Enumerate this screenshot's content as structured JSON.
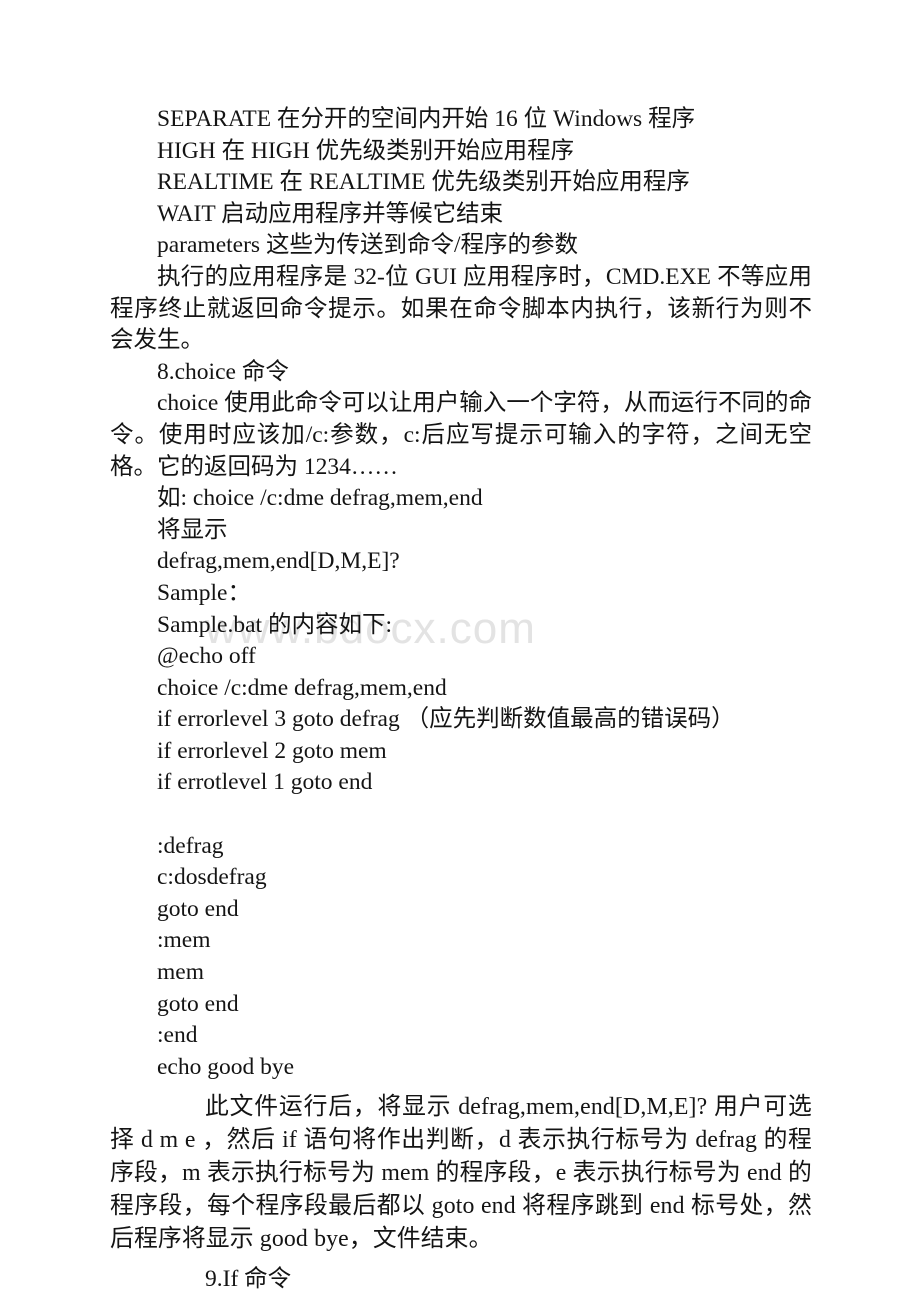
{
  "document": {
    "watermark": "www.bdocx.com",
    "text_color": "#141414",
    "watermark_color": "#e3e3e3",
    "background_color": "#ffffff",
    "start_switches": [
      "SEPARATE 在分开的空间内开始 16 位 Windows 程序",
      "HIGH 在 HIGH 优先级类别开始应用程序",
      "REALTIME 在 REALTIME 优先级类别开始应用程序",
      "WAIT 启动应用程序并等候它结束",
      "parameters 这些为传送到命令/程序的参数"
    ],
    "gui_note": "执行的应用程序是 32-位 GUI 应用程序时，CMD.EXE 不等应用程序终止就返回命令提示。如果在命令脚本内执行，该新行为则不会发生。",
    "section_choice_heading": "8.choice 命令",
    "choice_description": "choice 使用此命令可以让用户输入一个字符，从而运行不同的命令。使用时应该加/c:参数，c:后应写提示可输入的字符，之间无空格。它的返回码为 1234……",
    "example_command": "如: choice /c:dme defrag,mem,end",
    "will_display_label": "将显示",
    "display_output": "defrag,mem,end[D,M,E]?",
    "sample_label": "Sample：",
    "sample_file_label": "Sample.bat 的内容如下:",
    "batch_lines_top": [
      "@echo off",
      "choice /c:dme defrag,mem,end",
      "if errorlevel 3 goto defrag （应先判断数值最高的错误码）",
      "if errorlevel 2 goto mem",
      "if errotlevel 1 goto end"
    ],
    "batch_lines_bottom": [
      ":defrag",
      "c:dosdefrag",
      "goto end",
      ":mem",
      "mem",
      "goto end",
      ":end",
      "echo good bye"
    ],
    "explanation": "此文件运行后，将显示 defrag,mem,end[D,M,E]? 用户可选择 d m e ，然后 if 语句将作出判断，d 表示执行标号为 defrag 的程序段，m 表示执行标号为 mem 的程序段，e 表示执行标号为 end 的程序段，每个程序段最后都以 goto end 将程序跳到 end 标号处，然后程序将显示 good bye，文件结束。",
    "section_if_heading": "9.If 命令"
  }
}
